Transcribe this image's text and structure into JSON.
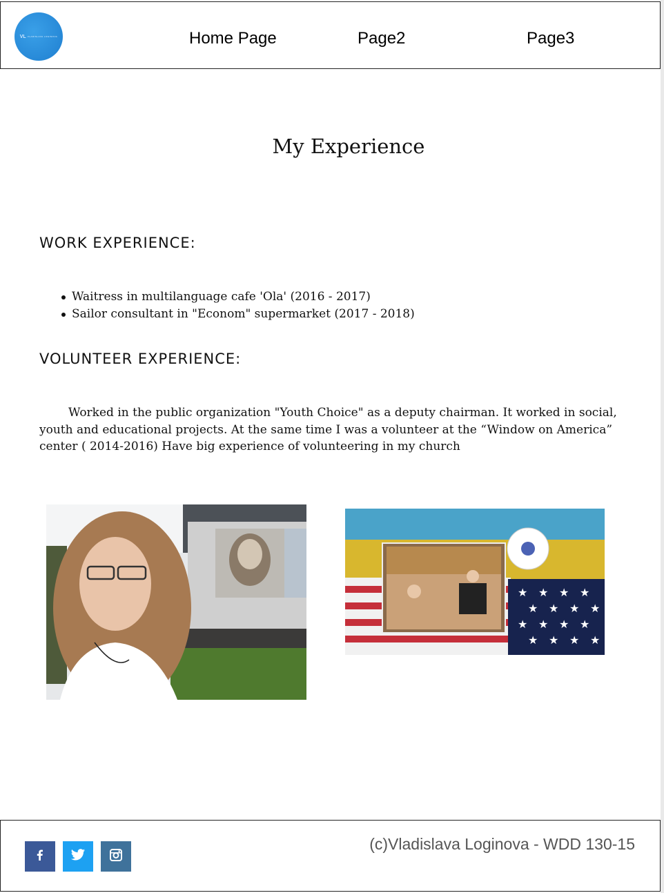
{
  "header": {
    "logo_mark": "VL",
    "logo_text": "VLADISLAVA LOGINOVA",
    "nav": [
      "Home Page",
      "Page2",
      "Page3"
    ]
  },
  "main": {
    "title": "My Experience",
    "work_heading": "WORK EXPERIENCE:",
    "work_items": [
      "Waitress in multilanguage cafe 'Ola' (2016 - 2017)",
      "Sailor consultant in \"Econom\" supermarket (2017 - 2018)"
    ],
    "volunteer_heading": "VOLUNTEER EXPERIENCE:",
    "volunteer_text": "Worked in the public organization \"Youth Choice\" as a deputy chairman. It worked in social, youth and educational projects. At the same time I was a volunteer at the “Window on America” center ( 2014-2016) Have big experience of volunteering in my church"
  },
  "footer": {
    "social": [
      {
        "icon": "facebook-icon",
        "color": "#3b5998"
      },
      {
        "icon": "twitter-icon",
        "color": "#1da1f2"
      },
      {
        "icon": "instagram-icon",
        "color": "#3f729b"
      }
    ],
    "copyright": "(c)Vladislava Loginova - WDD 130-15"
  }
}
